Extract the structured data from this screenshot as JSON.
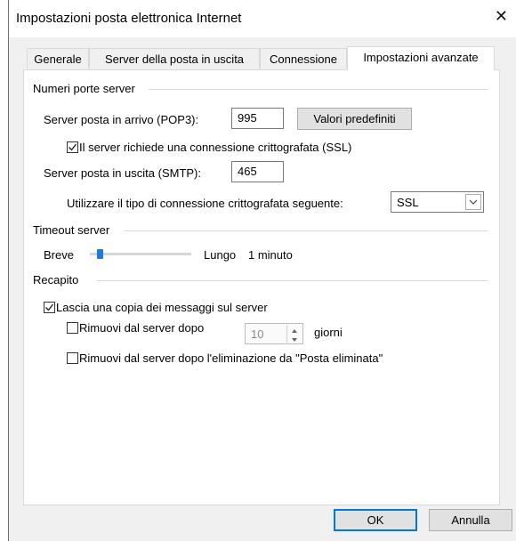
{
  "window": {
    "title": "Impostazioni posta elettronica Internet",
    "close_glyph": "✕"
  },
  "tabs": [
    {
      "label": "Generale",
      "active": false
    },
    {
      "label": "Server della posta in uscita",
      "active": false
    },
    {
      "label": "Connessione",
      "active": false
    },
    {
      "label": "Impostazioni avanzate",
      "active": true
    }
  ],
  "ports": {
    "section_title": "Numeri porte server",
    "incoming_label": "Server posta in arrivo (POP3):",
    "incoming_value": "995",
    "defaults_button": "Valori predefiniti",
    "ssl_label": "Il server richiede una connessione crittografata (SSL)",
    "ssl_checked": true,
    "outgoing_label": "Server posta in uscita (SMTP):",
    "outgoing_value": "465",
    "encryption_label": "Utilizzare il tipo di connessione crittografata seguente:",
    "encryption_value": "SSL"
  },
  "timeout": {
    "section_title": "Timeout server",
    "short_label": "Breve",
    "long_label": "Lungo",
    "value_label": "1 minuto",
    "slider_fraction": 0.1
  },
  "delivery": {
    "section_title": "Recapito",
    "keep_copy_label": "Lascia una copia dei messaggi sul server",
    "keep_copy_checked": true,
    "remove_after_label": "Rimuovi dal server dopo",
    "remove_after_checked": false,
    "remove_after_days": "10",
    "days_unit": "giorni",
    "remove_deleted_label": "Rimuovi dal server dopo l'eliminazione da \"Posta eliminata\"",
    "remove_deleted_checked": false
  },
  "footer": {
    "ok_label": "OK",
    "cancel_label": "Annulla"
  },
  "colors": {
    "accent": "#0078d7",
    "dialog_bg": "#f0f0f0",
    "panel_bg": "#ffffff",
    "slider_thumb": "#1f7ae0"
  }
}
